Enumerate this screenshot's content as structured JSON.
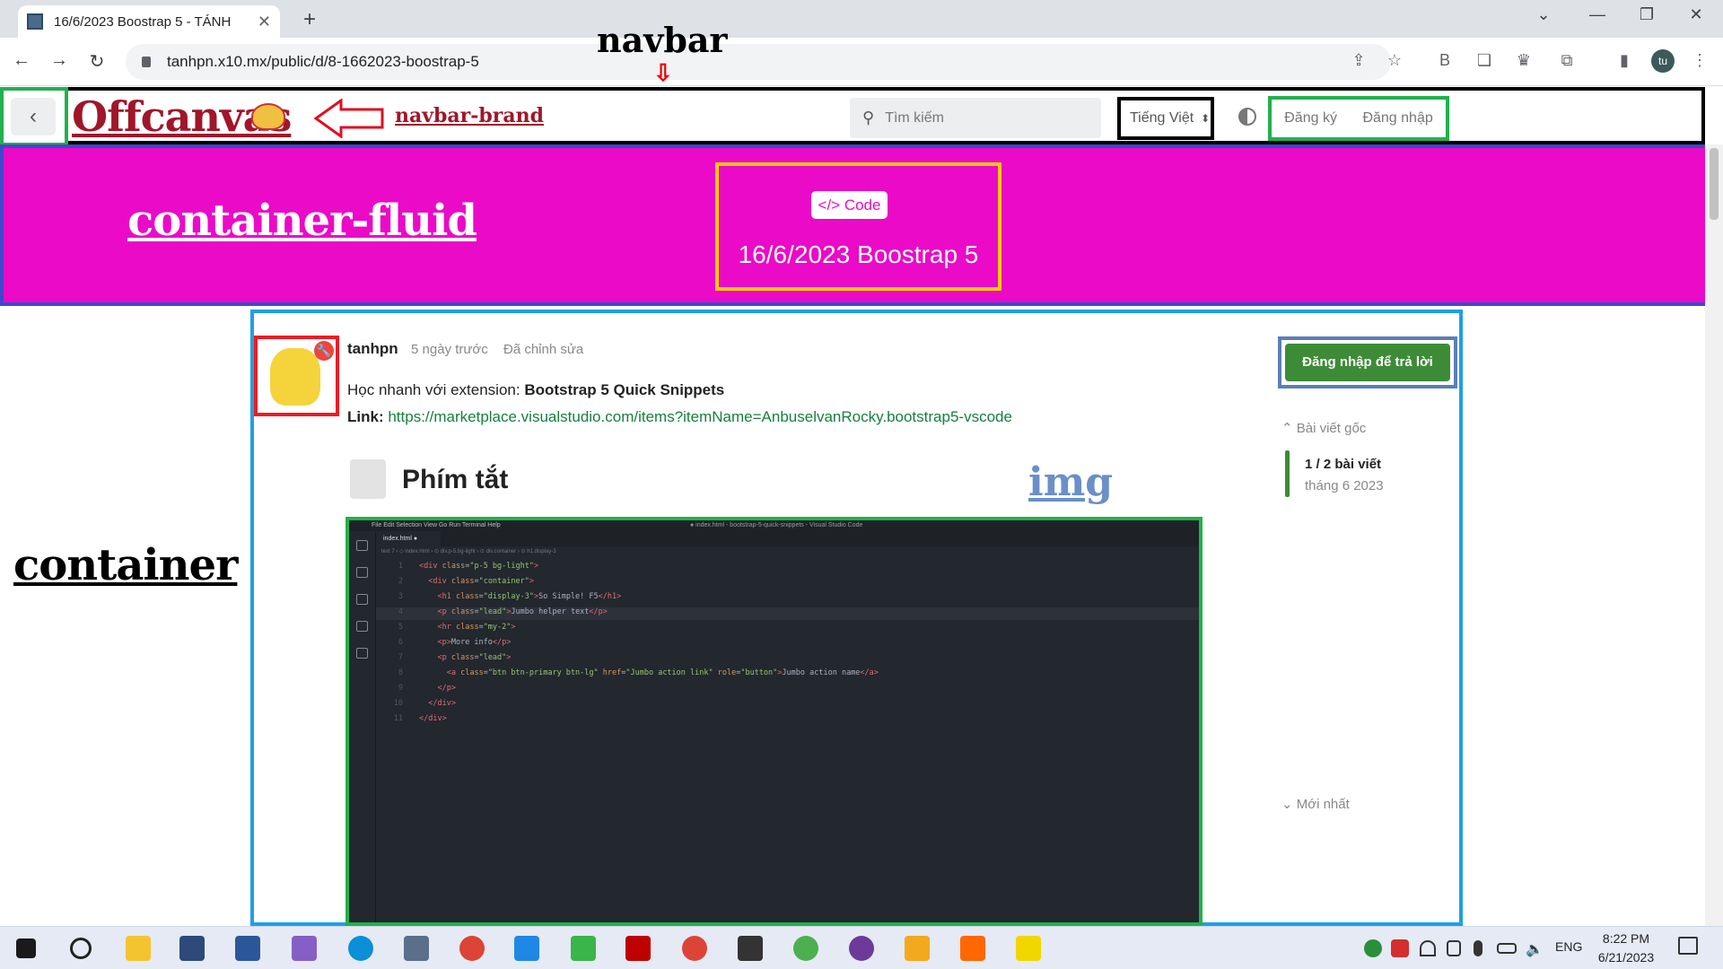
{
  "browser": {
    "tab_title": "16/6/2023 Boostrap 5 - TÁNH",
    "url": "tanhpn.x10.mx/public/d/8-1662023-boostrap-5",
    "profile_initials": "tu"
  },
  "annotations": {
    "navbar": "navbar",
    "brand": "navbar-brand",
    "container_fluid": "container-fluid",
    "container": "container",
    "img": "img"
  },
  "navbar": {
    "brand_text": "Offcanvas",
    "search_placeholder": "Tìm kiếm",
    "language": "Tiếng Việt",
    "register": "Đăng ký",
    "login": "Đăng nhập"
  },
  "hero": {
    "badge": "Code",
    "title": "16/6/2023 Boostrap 5",
    "background": "#ea0ac8"
  },
  "post": {
    "author": "tanhpn",
    "time": "5 ngày trước",
    "edited": "Đã chỉnh sửa",
    "line1_prefix": "Học nhanh với extension: ",
    "line1_bold": "Bootstrap 5 Quick Snippets",
    "line2_prefix": "Link: ",
    "link": "https://marketplace.visualstudio.com/items?itemName=AnbuselvanRocky.bootstrap5-vscode",
    "heading": "Phím tắt"
  },
  "vscode": {
    "menu": "File   Edit   Selection   View   Go   Run   Terminal   Help",
    "window_title": "● index.html - bootstrap-5-quick-snippets - Visual Studio Code",
    "file_tab": "index.html ●",
    "breadcrumbs": "text 7 › ◇ index.html › ⊙ div.p-5.bg-light › ⊙ div.container › ⊙ h1.display-3",
    "lines": [
      {
        "n": "1",
        "html": "<span class=\"tag\">&lt;div</span> <span class=\"attr\">class</span>=<span class=\"str\">\"p-5 bg-light\"</span><span class=\"tag\">&gt;</span>"
      },
      {
        "n": "2",
        "html": "  <span class=\"tag\">&lt;div</span> <span class=\"attr\">class</span>=<span class=\"str\">\"container\"</span><span class=\"tag\">&gt;</span>"
      },
      {
        "n": "3",
        "html": "    <span class=\"tag\">&lt;h1</span> <span class=\"attr\">class</span>=<span class=\"str\">\"display-3\"</span><span class=\"tag\">&gt;</span>So Simple! F5<span class=\"tag\">&lt;/h1&gt;</span>"
      },
      {
        "n": "4",
        "html": "    <span class=\"tag\">&lt;p</span> <span class=\"attr\">class</span>=<span class=\"str\">\"lead\"</span><span class=\"tag\">&gt;</span>Jumbo helper text<span class=\"tag\">&lt;/p&gt;</span>"
      },
      {
        "n": "5",
        "html": "    <span class=\"tag\">&lt;hr</span> <span class=\"attr\">class</span>=<span class=\"str\">\"my-2\"</span><span class=\"tag\">&gt;</span>"
      },
      {
        "n": "6",
        "html": "    <span class=\"tag\">&lt;p&gt;</span>More info<span class=\"tag\">&lt;/p&gt;</span>"
      },
      {
        "n": "7",
        "html": "    <span class=\"tag\">&lt;p</span> <span class=\"attr\">class</span>=<span class=\"str\">\"lead\"</span><span class=\"tag\">&gt;</span>"
      },
      {
        "n": "8",
        "html": "      <span class=\"tag\">&lt;a</span> <span class=\"attr\">class</span>=<span class=\"str\">\"btn btn-primary btn-lg\"</span> <span class=\"attr\">href</span>=<span class=\"str\">\"Jumbo action link\"</span> <span class=\"attr\">role</span>=<span class=\"str\">\"button\"</span><span class=\"tag\">&gt;</span>Jumbo action name<span class=\"tag\">&lt;/a&gt;</span>"
      },
      {
        "n": "9",
        "html": "    <span class=\"tag\">&lt;/p&gt;</span>"
      },
      {
        "n": "10",
        "html": "  <span class=\"tag\">&lt;/div&gt;</span>"
      },
      {
        "n": "11",
        "html": "<span class=\"tag\">&lt;/div&gt;</span>"
      }
    ]
  },
  "sidebar": {
    "reply_button": "Đăng nhập để trả lời",
    "original_post": "Bài viết gốc",
    "post_count": "1 / 2 bài viết",
    "date": "tháng 6 2023",
    "latest": "Mới nhất"
  },
  "taskbar": {
    "language": "ENG",
    "time": "8:22 PM",
    "date": "6/21/2023"
  }
}
